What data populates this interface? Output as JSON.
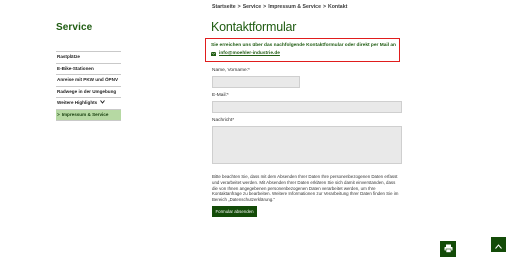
{
  "breadcrumb": {
    "items": [
      "Startseite",
      "Service",
      "Impressum & Service",
      "Kontakt"
    ],
    "separator": ">"
  },
  "sidebar": {
    "title": "Service",
    "items": [
      {
        "label": "Rastplätze"
      },
      {
        "label": "E-Bike-Stationen"
      },
      {
        "label": "Anreise mit PKW und ÖPNV"
      },
      {
        "label": "Radwege in der Umgebung"
      },
      {
        "label": "Weitere Highlights",
        "icon": "chevron-down-icon"
      },
      {
        "label": "Impressum & Service",
        "prefix": ">",
        "active": true
      }
    ]
  },
  "main": {
    "title": "Kontaktformular",
    "notice": {
      "text": "Sie erreichen uns über das nachfolgende Kontaktformular oder direkt per Mail an",
      "email": "info@moehler-industrie.de",
      "icon": "mail-icon"
    },
    "form": {
      "name_label": "Name, Vorname:*",
      "email_label": "E-Mail:*",
      "message_label": "Nachricht*",
      "name_value": "",
      "email_value": "",
      "message_value": "",
      "privacy_text": "Bitte beachten Sie, dass mit dem Absenden Ihrer Daten Ihre personenbezogenen Daten erfasst und verarbeitet werden. Mit Absenden Ihrer Daten erklären Sie sich damit einverstanden, dass die von Ihnen angegebenen personenbezogenen Daten verarbeitet werden, um Ihre Kontaktanfrage zu bearbeiten. Weitere Informationen zur Verarbeitung Ihrer Daten finden Sie im Bereich „Datenschutzerklärung.“",
      "submit_label": "Formular absenden"
    }
  },
  "floating": {
    "print_icon": "print-icon",
    "top_icon": "arrow-up-icon"
  },
  "colors": {
    "brand_green": "#1f5c12",
    "dark_green": "#134b08",
    "active_bg": "#b6d9a3",
    "highlight_border": "#e01d1d"
  }
}
